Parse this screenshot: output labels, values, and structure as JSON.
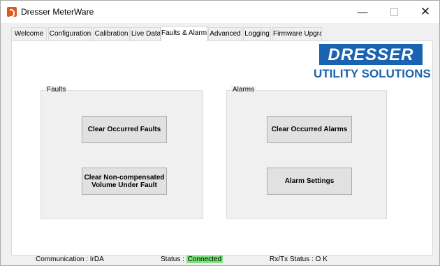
{
  "window": {
    "title": "Dresser MeterWare",
    "minimize_glyph": "—",
    "close_glyph": "✕"
  },
  "tabs": [
    {
      "label": "Welcome"
    },
    {
      "label": "Configuration"
    },
    {
      "label": "Calibration"
    },
    {
      "label": "Live Data"
    },
    {
      "label": "Faults & Alarms"
    },
    {
      "label": "Advanced"
    },
    {
      "label": "Logging"
    },
    {
      "label": "Firmware Upgrade"
    }
  ],
  "active_tab": "Faults & Alarms",
  "logo": {
    "word": "DRESSER",
    "subtitle": "UTILITY SOLUTIONS"
  },
  "faults": {
    "label": "Faults",
    "clear_occurred": "Clear Occurred Faults",
    "clear_noncompensated": "Clear Non-compensated Volume Under Fault"
  },
  "alarms": {
    "label": "Alarms",
    "clear_occurred": "Clear Occurred Alarms",
    "settings": "Alarm Settings"
  },
  "status": {
    "communication": "Communication : IrDA",
    "status_label": "Status :",
    "status_value": "Connected",
    "rxtx": "Rx/Tx Status : O K"
  },
  "colors": {
    "logo_blue": "#1a63b1",
    "connected_green": "#7ee07e",
    "app_icon_orange": "#e2571e"
  }
}
